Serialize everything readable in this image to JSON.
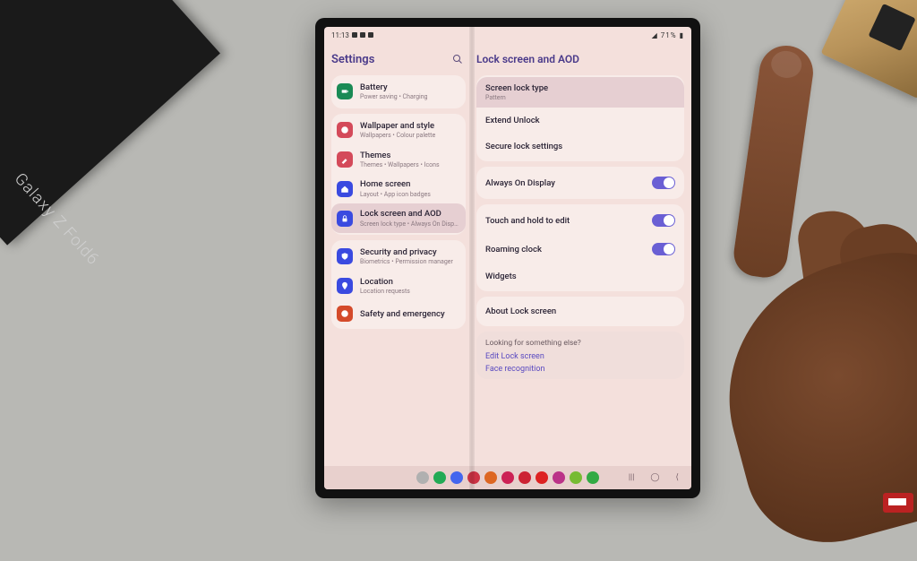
{
  "product_box_text": "Galaxy Z Fold6",
  "statusbar": {
    "time": "11:13",
    "battery_text": "71%"
  },
  "left": {
    "title": "Settings",
    "groups": [
      {
        "items": [
          {
            "icon_color": "#1a8a55",
            "icon": "battery",
            "title": "Battery",
            "sub": "Power saving  •  Charging"
          }
        ]
      },
      {
        "items": [
          {
            "icon_color": "#d44a5a",
            "icon": "palette",
            "title": "Wallpaper and style",
            "sub": "Wallpapers  •  Colour palette"
          },
          {
            "icon_color": "#d44a5a",
            "icon": "brush",
            "title": "Themes",
            "sub": "Themes  •  Wallpapers  •  Icons"
          },
          {
            "icon_color": "#3a4ae0",
            "icon": "home",
            "title": "Home screen",
            "sub": "Layout  •  App icon badges"
          },
          {
            "icon_color": "#3a4ae0",
            "icon": "lock",
            "title": "Lock screen and AOD",
            "sub": "Screen lock type  •  Always On Display",
            "selected": true
          }
        ]
      },
      {
        "items": [
          {
            "icon_color": "#3a4ae0",
            "icon": "shield",
            "title": "Security and privacy",
            "sub": "Biometrics  •  Permission manager"
          },
          {
            "icon_color": "#3a4ae0",
            "icon": "pin",
            "title": "Location",
            "sub": "Location requests"
          },
          {
            "icon_color": "#d44a2a",
            "icon": "sos",
            "title": "Safety and emergency",
            "sub": ""
          }
        ]
      }
    ]
  },
  "right": {
    "title": "Lock screen and AOD",
    "cards": [
      {
        "items": [
          {
            "title": "Screen lock type",
            "sub": "Pattern",
            "highlight": true
          },
          {
            "title": "Extend Unlock"
          },
          {
            "title": "Secure lock settings"
          }
        ]
      },
      {
        "items": [
          {
            "title": "Always On Display",
            "toggle": true
          }
        ]
      },
      {
        "items": [
          {
            "title": "Touch and hold to edit",
            "toggle": true
          },
          {
            "title": "Roaming clock",
            "toggle": true
          },
          {
            "title": "Widgets"
          }
        ]
      },
      {
        "items": [
          {
            "title": "About Lock screen"
          }
        ]
      }
    ],
    "looking": {
      "question": "Looking for something else?",
      "links": [
        "Edit Lock screen",
        "Face recognition"
      ]
    }
  },
  "taskbar_colors": [
    "#b0b0b0",
    "#22aa55",
    "#4466ee",
    "#cc3344",
    "#dd6622",
    "#cc2255",
    "#cc2233",
    "#dd2222",
    "#bb3388",
    "#77bb33",
    "#33aa44"
  ]
}
